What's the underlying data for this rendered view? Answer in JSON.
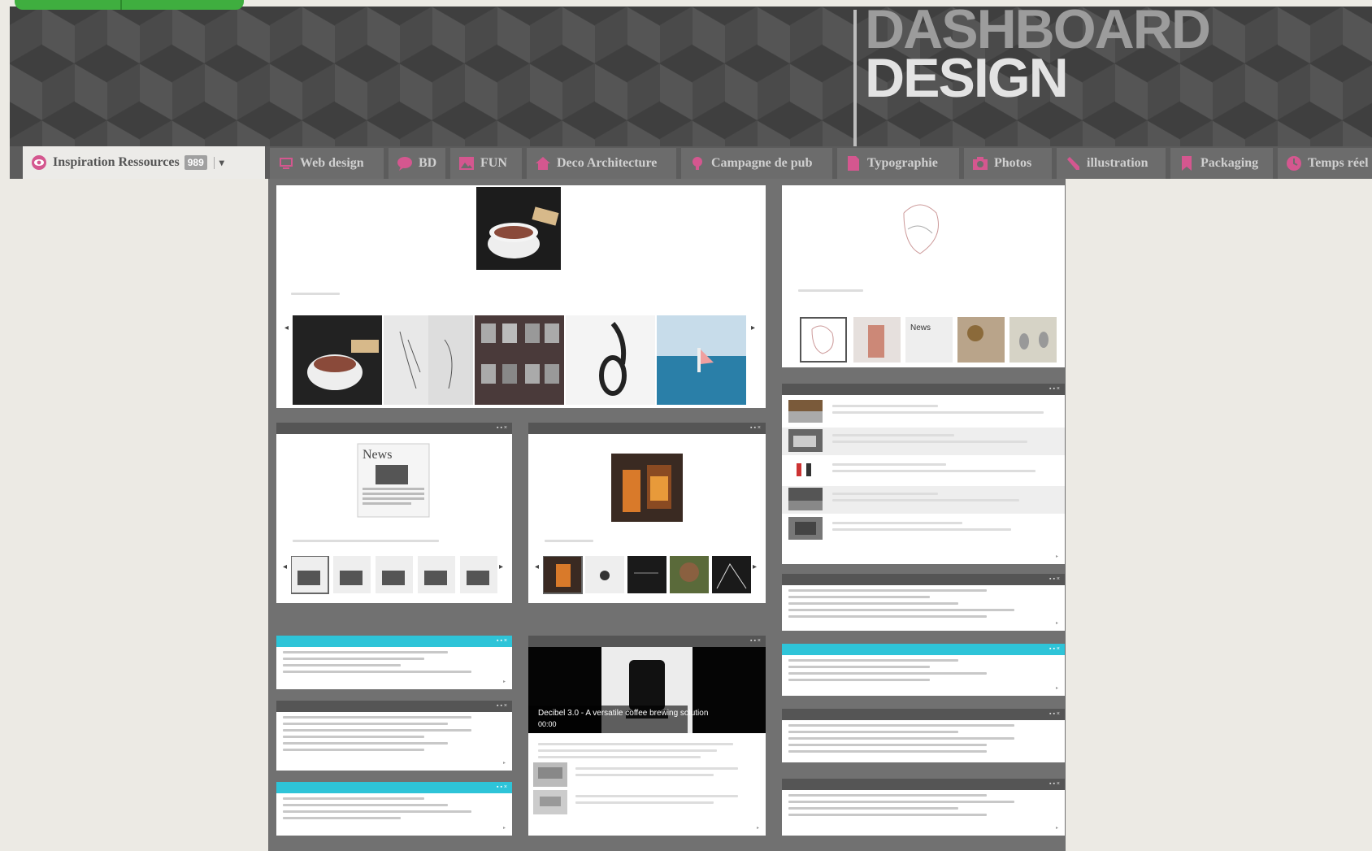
{
  "brand": {
    "line1": "DASHBOARD",
    "line2": "DESIGN"
  },
  "tabs": [
    {
      "label": "Inspiration Ressources",
      "icon": "eye-icon",
      "badge": "989"
    },
    {
      "label": "Web design",
      "icon": "monitor-icon"
    },
    {
      "label": "BD",
      "icon": "speech-bubble-icon"
    },
    {
      "label": "FUN",
      "icon": "image-icon"
    },
    {
      "label": "Deco Architecture",
      "icon": "home-icon"
    },
    {
      "label": "Campagne de pub",
      "icon": "lightbulb-icon"
    },
    {
      "label": "Typographie",
      "icon": "document-icon"
    },
    {
      "label": "Photos",
      "icon": "camera-icon"
    },
    {
      "label": "illustration",
      "icon": "pencil-icon"
    },
    {
      "label": "Packaging",
      "icon": "bookmark-icon"
    },
    {
      "label": "Temps réel",
      "icon": "clock-icon"
    }
  ],
  "panels": {
    "news": {
      "image_label": "News"
    },
    "video": {
      "caption": "Decibel 3.0 - A versatile coffee brewing solution",
      "time": "00:00"
    }
  },
  "colors": {
    "accent_pink": "#d4578f",
    "cyan": "#2ec4d8",
    "green": "#3fae3f"
  }
}
